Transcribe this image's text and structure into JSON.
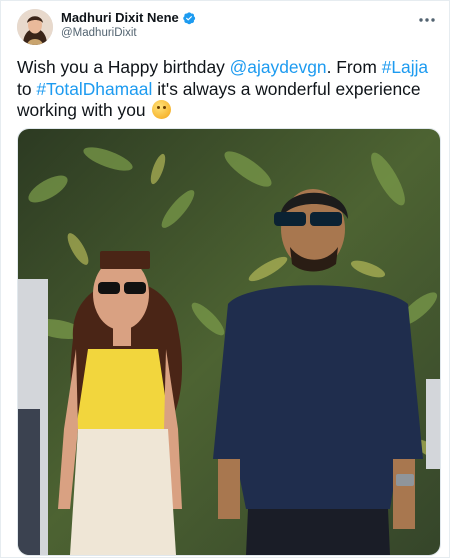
{
  "author": {
    "display_name": "Madhuri Dixit Nene",
    "handle": "@MadhuriDixit",
    "verified": true
  },
  "tweet": {
    "text_intro": "Wish you a Happy birthday ",
    "mention": "@ajaydevgn",
    "text_mid1": ". From ",
    "hashtag1": "#Lajja",
    "text_mid2": " to ",
    "hashtag2": "#TotalDhamaal",
    "text_end": " it's always a wonderful experience working with you",
    "emoji_name": "hugging-face-emoji"
  },
  "photo": {
    "description_icon": "photo"
  },
  "colors": {
    "link": "#1d9bf0",
    "verified": "#1d9bf0",
    "text": "#0f1419",
    "secondary": "#536471"
  }
}
